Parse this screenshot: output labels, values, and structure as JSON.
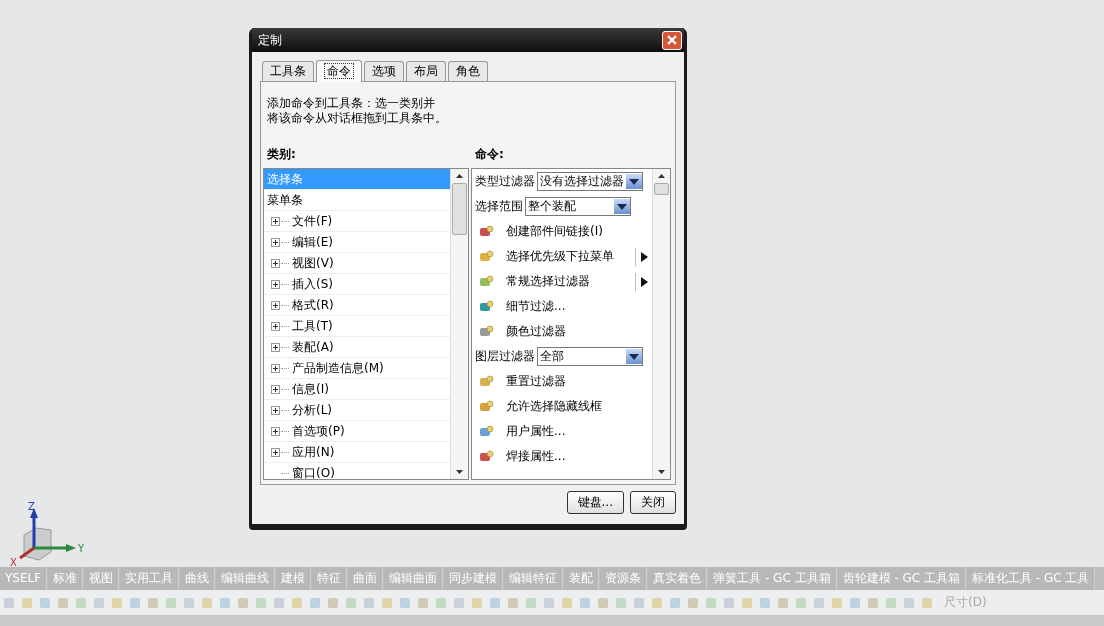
{
  "window": {
    "title": "定制"
  },
  "tabs": [
    {
      "label": "工具条",
      "selected": false
    },
    {
      "label": "命令",
      "selected": true
    },
    {
      "label": "选项",
      "selected": false
    },
    {
      "label": "布局",
      "selected": false
    },
    {
      "label": "角色",
      "selected": false
    }
  ],
  "instructions": [
    "添加命令到工具条：选一类别并",
    "将该命令从对话框拖到工具条中。"
  ],
  "category_label": "类别:",
  "categories": [
    {
      "label": "选择条",
      "selected": true
    },
    {
      "label": "菜单条",
      "selected": false,
      "children": [
        {
          "label": "文件(F)",
          "expandable": true
        },
        {
          "label": "编辑(E)",
          "expandable": true
        },
        {
          "label": "视图(V)",
          "expandable": true
        },
        {
          "label": "插入(S)",
          "expandable": true
        },
        {
          "label": "格式(R)",
          "expandable": true
        },
        {
          "label": "工具(T)",
          "expandable": true
        },
        {
          "label": "装配(A)",
          "expandable": true
        },
        {
          "label": "产品制造信息(M)",
          "expandable": true
        },
        {
          "label": "信息(I)",
          "expandable": true
        },
        {
          "label": "分析(L)",
          "expandable": true
        },
        {
          "label": "首选项(P)",
          "expandable": true
        },
        {
          "label": "应用(N)",
          "expandable": true
        },
        {
          "label": "窗口(O)",
          "expandable": false
        }
      ]
    }
  ],
  "command_label": "命令:",
  "commands": [
    {
      "kind": "dropdown",
      "label": "类型过滤器",
      "value": "没有选择过滤器"
    },
    {
      "kind": "dropdown",
      "label": "选择范围",
      "value": "整个装配"
    },
    {
      "kind": "command",
      "label": "创建部件间链接(I)",
      "submenu": false
    },
    {
      "kind": "command",
      "label": "选择优先级下拉菜单",
      "submenu": true
    },
    {
      "kind": "command",
      "label": "常规选择过滤器",
      "submenu": true
    },
    {
      "kind": "command",
      "label": "细节过滤...",
      "submenu": false
    },
    {
      "kind": "command",
      "label": "颜色过滤器",
      "submenu": false
    },
    {
      "kind": "dropdown",
      "label": "图层过滤器",
      "value": "全部"
    },
    {
      "kind": "command",
      "label": "重置过滤器",
      "submenu": false
    },
    {
      "kind": "command",
      "label": "允许选择隐藏线框",
      "submenu": false
    },
    {
      "kind": "command",
      "label": "用户属性...",
      "submenu": false
    },
    {
      "kind": "command",
      "label": "焊接属性...",
      "submenu": false
    }
  ],
  "buttons": [
    "键盘...",
    "关闭"
  ],
  "axes": [
    "Z",
    "Y",
    "X"
  ],
  "toolbar_tabs": [
    "YSELF",
    "标准",
    "视图",
    "实用工具",
    "曲线",
    "编辑曲线",
    "建模",
    "特征",
    "曲面",
    "编辑曲面",
    "同步建模",
    "编辑特征",
    "装配",
    "资源条",
    "真实着色",
    "弹簧工具 - GC 工具箱",
    "齿轮建模 - GC 工具箱",
    "标准化工具 - GC 工具"
  ],
  "toolbar": {
    "trailing_label": "尺寸(D)"
  }
}
